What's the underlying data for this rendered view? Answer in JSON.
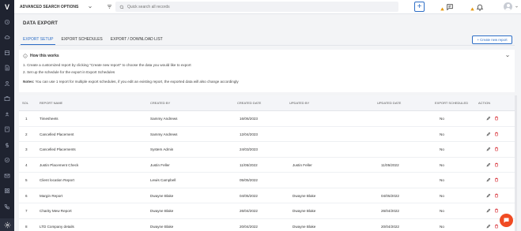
{
  "sidebar": {
    "logo": "V",
    "icons": [
      "history-icon",
      "cloud-icon",
      "calendar-icon",
      "document-icon",
      "user-icon",
      "briefcase-icon",
      "contact-icon",
      "building-icon",
      "dollar-icon",
      "clock-icon",
      "mail-icon",
      "grid-icon",
      "phone-icon",
      "dots-icon"
    ],
    "bottom_icon": "settings-icon"
  },
  "topbar": {
    "advanced_search_label": "ADVANCED SEARCH OPTIONS",
    "search_placeholder": "Quick search all records",
    "add_label": "+"
  },
  "page": {
    "title": "DATA EXPORT",
    "tabs": [
      {
        "label": "EXPORT SETUP",
        "active": true
      },
      {
        "label": "EXPORT SCHEDULES",
        "active": false
      },
      {
        "label": "EXPORT / DOWNLOAD LIST",
        "active": false
      }
    ],
    "create_button": "+ Create new report"
  },
  "how": {
    "title": "How this works",
    "step1": "1. Create a customized report by clicking \"Create new report\" to choose the data you would like to export",
    "step2": "2. Set up the schedule for the export in Export Schedules",
    "notes_label": "Notes:",
    "notes_text": " You can use 1 report for multiple export schedules, if you edit an existing report, the exported data will also change accordingly"
  },
  "table": {
    "headers": {
      "sl": "SOL",
      "report_name": "REPORT NAME",
      "created_by": "CREATED BY",
      "created_date": "CREATED DATE",
      "updated_by": "UPDATED BY",
      "updated_date": "UPDATED DATE",
      "export_scheduled": "EXPORT SCHEDULED",
      "action": "ACTION"
    },
    "rows": [
      {
        "sl": "1",
        "name": "Timesheets",
        "created_by": "Sammy Andrews",
        "created_date": "16/06/2023",
        "updated_by": "",
        "updated_date": "",
        "scheduled": "No"
      },
      {
        "sl": "2",
        "name": "Cancelled Placement",
        "created_by": "Sammy Andrews",
        "created_date": "12/04/2023",
        "updated_by": "",
        "updated_date": "",
        "scheduled": "No"
      },
      {
        "sl": "3",
        "name": "Cancelled Placements",
        "created_by": "System Admin",
        "created_date": "24/03/2023",
        "updated_by": "",
        "updated_date": "",
        "scheduled": "No"
      },
      {
        "sl": "4",
        "name": "Justin Placement Check",
        "created_by": "Justin Feller",
        "created_date": "11/05/2022",
        "updated_by": "Justin Feller",
        "updated_date": "11/05/2022",
        "scheduled": "No"
      },
      {
        "sl": "5",
        "name": "Client location Report",
        "created_by": "Lewis Campbell",
        "created_date": "05/05/2022",
        "updated_by": "",
        "updated_date": "",
        "scheduled": "No"
      },
      {
        "sl": "6",
        "name": "Margin Report",
        "created_by": "Dwayne Blake",
        "created_date": "04/05/2022",
        "updated_by": "Dwayne Blake",
        "updated_date": "04/05/2022",
        "scheduled": "No"
      },
      {
        "sl": "7",
        "name": "Charity Mew Report",
        "created_by": "Dwayne Blake",
        "created_date": "26/04/2022",
        "updated_by": "Dwayne Blake",
        "updated_date": "26/04/2022",
        "scheduled": "No"
      },
      {
        "sl": "8",
        "name": "LTD Company details",
        "created_by": "Dwayne Blake",
        "created_date": "20/04/2022",
        "updated_by": "Dwayne Blake",
        "updated_date": "20/04/2022",
        "scheduled": "No"
      }
    ]
  },
  "colors": {
    "accent": "#2d6ec6",
    "sidebar": "#1f2330",
    "delete": "#d9343b",
    "warning": "#e89b12",
    "chat": "#f04b23"
  }
}
